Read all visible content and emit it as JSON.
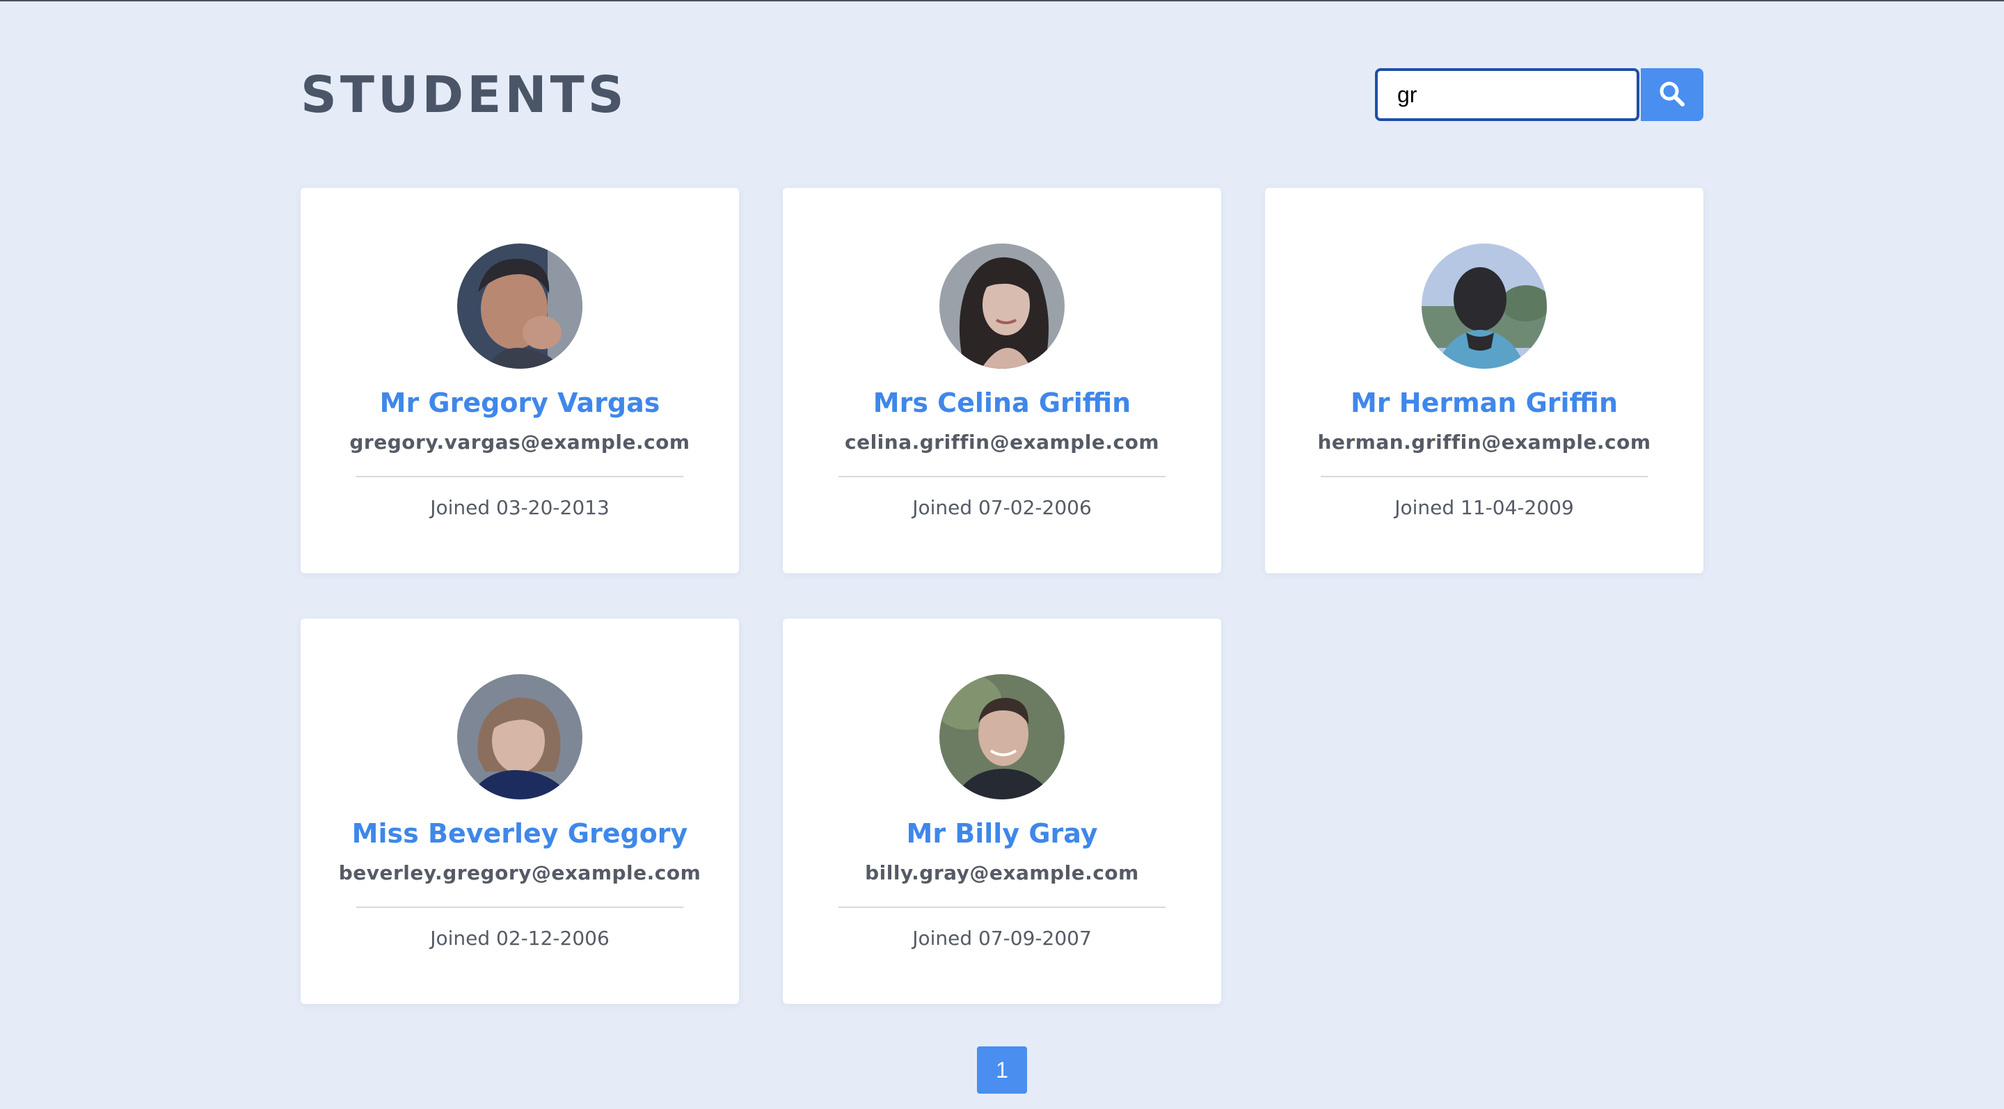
{
  "header": {
    "title": "STUDENTS"
  },
  "search": {
    "value": "gr",
    "button_icon": "search-icon"
  },
  "students": [
    {
      "name": "Mr Gregory Vargas",
      "email": "gregory.vargas@example.com",
      "joined": "Joined 03-20-2013"
    },
    {
      "name": "Mrs Celina Griffin",
      "email": "celina.griffin@example.com",
      "joined": "Joined 07-02-2006"
    },
    {
      "name": "Mr Herman Griffin",
      "email": "herman.griffin@example.com",
      "joined": "Joined 11-04-2009"
    },
    {
      "name": "Miss Beverley Gregory",
      "email": "beverley.gregory@example.com",
      "joined": "Joined 02-12-2006"
    },
    {
      "name": "Mr Billy Gray",
      "email": "billy.gray@example.com",
      "joined": "Joined 07-09-2007"
    }
  ],
  "pagination": {
    "current_page": "1"
  },
  "colors": {
    "background": "#e5ecf8",
    "accent": "#4a8ef0",
    "name_text": "#3f87ea",
    "title_text": "#4a5568",
    "body_text": "#555b66"
  }
}
